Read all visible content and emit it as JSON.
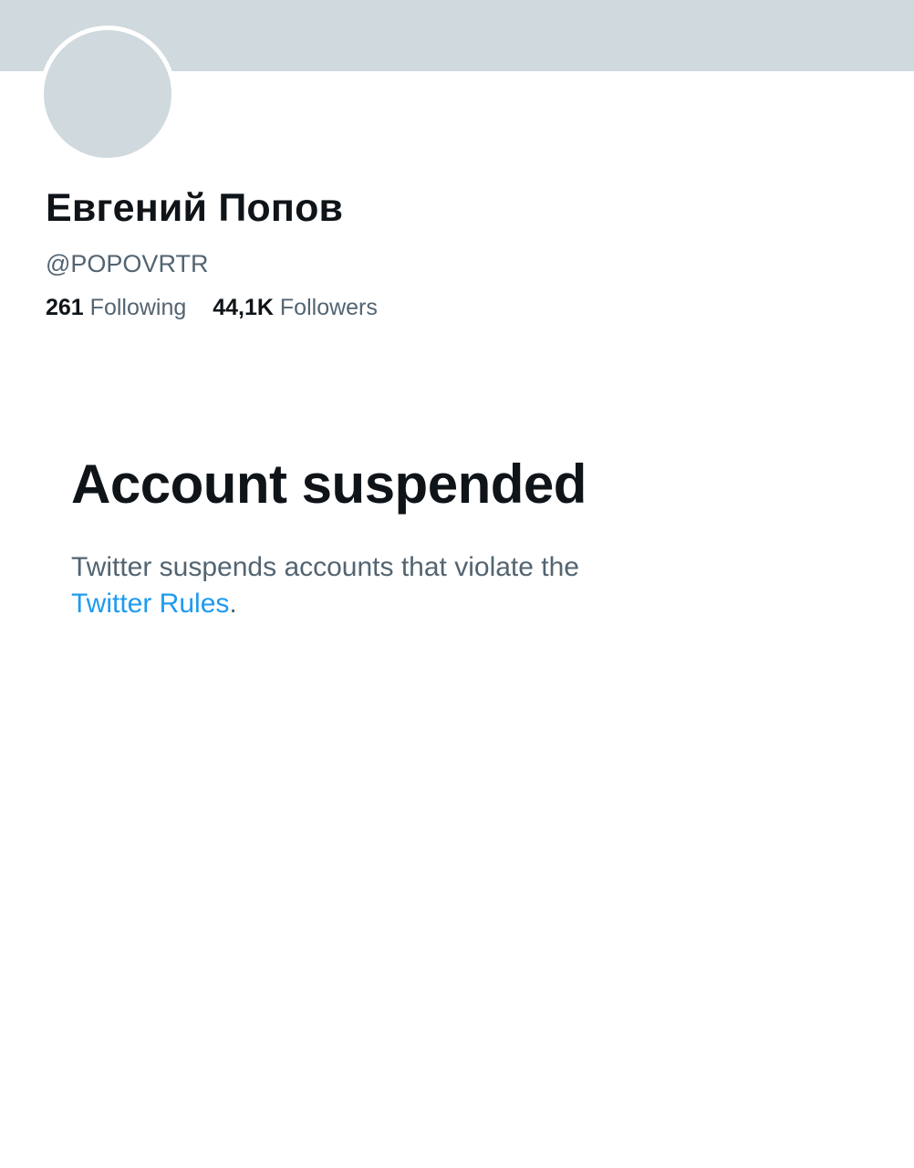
{
  "profile": {
    "display_name": "Евгений Попов",
    "handle": "@POPOVRTR",
    "following_count": "261",
    "following_label": "Following",
    "followers_count": "44,1K",
    "followers_label": "Followers"
  },
  "suspension": {
    "title": "Account suspended",
    "description_prefix": "Twitter suspends accounts that violate the",
    "rules_link_label": "Twitter Rules",
    "description_suffix": "."
  },
  "colors": {
    "banner": "#cfd9de",
    "avatar_placeholder": "#cfd9de",
    "primary_text": "#0f1419",
    "secondary_text": "#536471",
    "link": "#1d9bf0"
  }
}
